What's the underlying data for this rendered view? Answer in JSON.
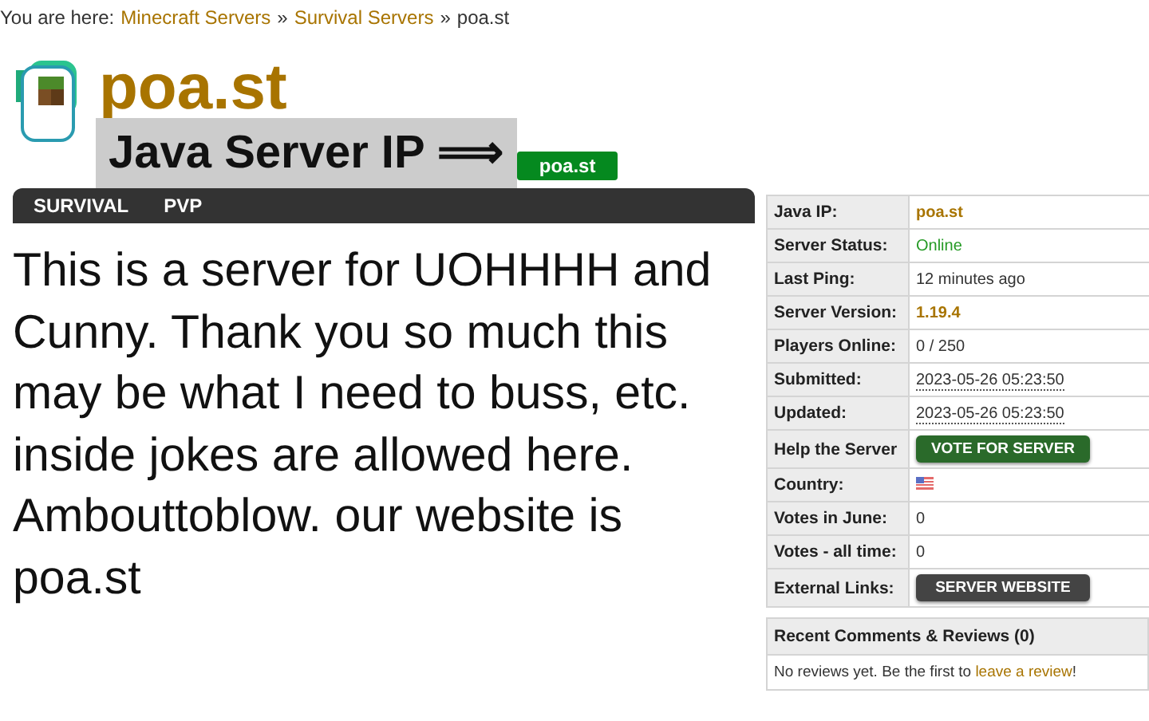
{
  "breadcrumb": {
    "prefix": "You are here:",
    "links": [
      "Minecraft Servers",
      "Survival Servers"
    ],
    "separator": "»",
    "current": "poa.st"
  },
  "header": {
    "title": "poa.st",
    "banner": "Java Server IP ⟹",
    "ip_badge": "poa.st"
  },
  "nav": {
    "tabs": [
      {
        "label": "SURVIVAL"
      },
      {
        "label": "PVP"
      }
    ]
  },
  "description": "This is a server for UOHHHH and Cunny. Thank you so much this may be what I need to buss, etc. inside jokes are allowed here. Ambouttoblow. our website is poa.st",
  "info_table": [
    {
      "label": "Java IP:",
      "kind": "accent",
      "value": "poa.st"
    },
    {
      "label": "Server Status:",
      "kind": "status",
      "value": "Online"
    },
    {
      "label": "Last Ping:",
      "kind": "text",
      "value": "12 minutes ago"
    },
    {
      "label": "Server Version:",
      "kind": "accent",
      "value": "1.19.4"
    },
    {
      "label": "Players Online:",
      "kind": "text",
      "value": "0 / 250"
    },
    {
      "label": "Submitted:",
      "kind": "date",
      "value": "2023-05-26 05:23:50"
    },
    {
      "label": "Updated:",
      "kind": "date",
      "value": "2023-05-26 05:23:50"
    },
    {
      "label": "Help the Server",
      "kind": "vote_button",
      "value": "VOTE FOR SERVER"
    },
    {
      "label": "Country:",
      "kind": "flag"
    },
    {
      "label": "Votes in June:",
      "kind": "text",
      "value": "0"
    },
    {
      "label": "Votes - all time:",
      "kind": "text",
      "value": "0"
    },
    {
      "label": "External Links:",
      "kind": "link_button",
      "value": "SERVER WEBSITE"
    }
  ],
  "reviews": {
    "title": "Recent Comments & Reviews (0)",
    "text_before": "No reviews yet. Be the first to",
    "link": "leave a review",
    "text_after": "!"
  }
}
